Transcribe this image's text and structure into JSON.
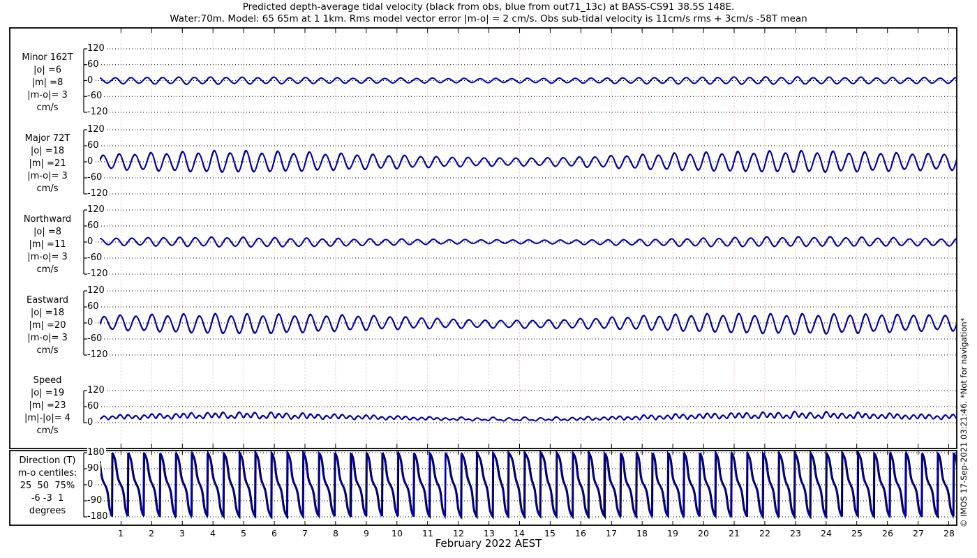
{
  "title": {
    "line1": "Predicted depth-average tidal velocity (black from obs, blue from out71_13c) at BASS-CS91 38.5S 148E.",
    "line2": "Water:70m. Model: 65 65m at 1 1km. Rms model vector error |m-o| = 2 cm/s. Obs sub-tidal velocity is 11cm/s rms + 3cm/s -58T mean"
  },
  "watermark": "© IMOS 17-Sep-2021 03:21:46. *Not for navigation*",
  "colors": {
    "model_line": "#0000bb",
    "obs_line": "#000000",
    "h_grid": "#000000",
    "v_grid": "#eed3d3",
    "frame": "#000000",
    "background": "#ffffff"
  },
  "xaxis": {
    "label": "February 2022 AEST",
    "tick_labels": [
      "1",
      "2",
      "3",
      "4",
      "5",
      "6",
      "7",
      "8",
      "9",
      "10",
      "11",
      "12",
      "13",
      "14",
      "15",
      "16",
      "17",
      "18",
      "19",
      "20",
      "21",
      "22",
      "23",
      "24",
      "25",
      "26",
      "27",
      "28"
    ]
  },
  "chart_data": {
    "type": "line",
    "x_unit": "day of February 2022 (AEST)",
    "x_range_days": [
      0.31,
      28.31
    ],
    "tidal_cycles_per_day": 1.9323,
    "grid": "dotted horizontal at ticks, light-pink vertical at each day",
    "series_legend": [
      {
        "name": "observations",
        "color": "black"
      },
      {
        "name": "model out71_13c",
        "color": "blue"
      }
    ],
    "panels": [
      {
        "id": "minor",
        "label_lines": [
          "Minor 162T",
          "|o| =6",
          "|m| =8",
          "|m-o|= 3",
          "cm/s"
        ],
        "unit": "cm/s",
        "yticks": [
          120,
          60,
          0,
          -60,
          -120
        ],
        "ylim": [
          -132,
          132
        ],
        "rms_obs": 6,
        "rms_model": 8,
        "rms_diff": 3,
        "waveform": "semidiurnal oscillation about 0",
        "amplitude_envelope_by_day": [
          10,
          11,
          12,
          13,
          13,
          12,
          12,
          11,
          10,
          10,
          9,
          9,
          8,
          8,
          8,
          9,
          9,
          10,
          11,
          12,
          12,
          13,
          13,
          13,
          12,
          12,
          11,
          11,
          10,
          10
        ]
      },
      {
        "id": "major",
        "label_lines": [
          "Major 72T",
          "|o| =18",
          "|m| =21",
          "|m-o|= 3",
          "cm/s"
        ],
        "unit": "cm/s",
        "yticks": [
          120,
          60,
          0,
          -60,
          -120
        ],
        "ylim": [
          -132,
          132
        ],
        "rms_obs": 18,
        "rms_model": 21,
        "rms_diff": 3,
        "waveform": "semidiurnal oscillation about 0, spring-neap modulated",
        "amplitude_envelope_by_day": [
          26,
          28,
          32,
          35,
          38,
          38,
          36,
          34,
          30,
          27,
          24,
          20,
          17,
          15,
          14,
          15,
          18,
          22,
          26,
          30,
          33,
          35,
          37,
          38,
          37,
          35,
          33,
          30,
          29,
          28
        ]
      },
      {
        "id": "northward",
        "label_lines": [
          "Northward",
          "|o| =8",
          "|m| =11",
          "|m-o|= 3",
          "cm/s"
        ],
        "unit": "cm/s",
        "yticks": [
          120,
          60,
          0,
          -60,
          -120
        ],
        "ylim": [
          -132,
          132
        ],
        "rms_obs": 8,
        "rms_model": 11,
        "rms_diff": 3,
        "waveform": "semidiurnal oscillation about 0",
        "amplitude_envelope_by_day": [
          12,
          13,
          15,
          16,
          17,
          17,
          16,
          15,
          14,
          12,
          11,
          9,
          8,
          7,
          7,
          7,
          8,
          10,
          11,
          13,
          15,
          16,
          17,
          17,
          17,
          16,
          15,
          13,
          13,
          12
        ]
      },
      {
        "id": "eastward",
        "label_lines": [
          "Eastward",
          "|o| =18",
          "|m| =20",
          "|m-o|= 3",
          "cm/s"
        ],
        "unit": "cm/s",
        "yticks": [
          120,
          60,
          0,
          -60,
          -120
        ],
        "ylim": [
          -132,
          132
        ],
        "rms_obs": 18,
        "rms_model": 20,
        "rms_diff": 3,
        "waveform": "semidiurnal oscillation about 0, spring-neap modulated",
        "amplitude_envelope_by_day": [
          25,
          27,
          30,
          33,
          35,
          35,
          34,
          32,
          29,
          26,
          23,
          19,
          16,
          14,
          14,
          15,
          18,
          21,
          25,
          29,
          32,
          34,
          35,
          36,
          35,
          34,
          32,
          29,
          28,
          27
        ]
      },
      {
        "id": "speed",
        "label_lines": [
          "Speed",
          "|o| =19",
          "|m| =23",
          "|m|-|o|= 4",
          "cm/s"
        ],
        "unit": "cm/s",
        "yticks": [
          120,
          60,
          0
        ],
        "ylim": [
          -6,
          132
        ],
        "rms_obs": 19,
        "rms_model": 23,
        "rms_diff": 4,
        "waveform": "positive, ripples ~2-35 cm/s at twice tidal frequency",
        "derived_from": "sqrt(eastward^2 + northward^2)"
      },
      {
        "id": "direction",
        "label_lines": [
          "Direction (T)",
          "m-o centiles:",
          "25  50  75%",
          "-6 -3  1",
          "degrees"
        ],
        "unit": "degrees true",
        "yticks": [
          180,
          90,
          0,
          -90,
          -180
        ],
        "ylim": [
          -190,
          190
        ],
        "centiles_pct": [
          25,
          50,
          75
        ],
        "centiles_deg": [
          -6,
          -3,
          1
        ],
        "waveform": "descending sawtooth wrapping +180 to -180 each semidiurnal cycle",
        "derived_from": "atan2(northward, eastward)"
      }
    ]
  }
}
